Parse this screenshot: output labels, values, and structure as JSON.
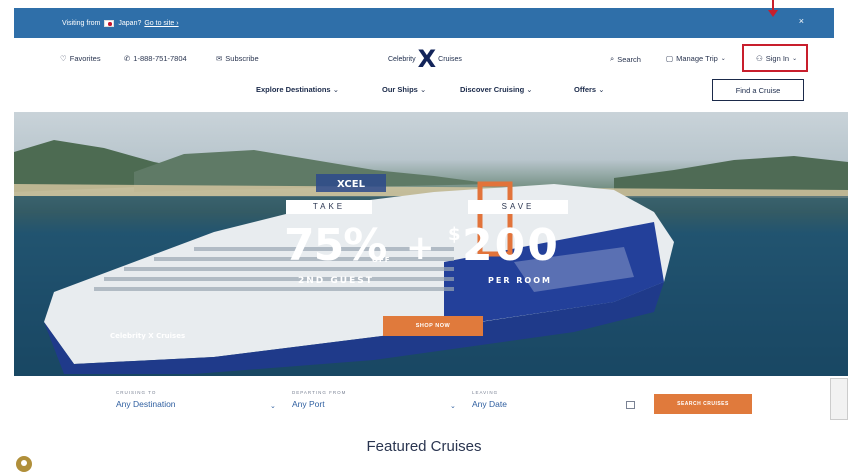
{
  "notice": {
    "visiting": "Visiting from",
    "country": "Japan?",
    "goto": "Go to site ›",
    "close": "×"
  },
  "utility": {
    "favorites": "Favorites",
    "phone": "1-888-751-7804",
    "subscribe": "Subscribe",
    "logo_left": "Celebrity",
    "logo_x": "X",
    "logo_right": "Cruises",
    "search": "Search",
    "manage_trip": "Manage Trip",
    "sign_in": "Sign In"
  },
  "nav": {
    "items": [
      "Explore Destinations",
      "Our Ships",
      "Discover Cruising",
      "Offers"
    ],
    "find_cruise": "Find a Cruise"
  },
  "hero": {
    "take": "TAKE",
    "pct": "75%",
    "off": "OFF",
    "second_guest": "2ND GUEST",
    "plus": "+",
    "dollar": "$",
    "amount": "200",
    "save": "SAVE",
    "per_room": "PER ROOM",
    "shop_now": "SHOP NOW",
    "xcel": "XCEL",
    "ship_logo": "Celebrity X Cruises"
  },
  "search": {
    "cruising_to_label": "CRUISING TO",
    "cruising_to_value": "Any Destination",
    "departing_label": "DEPARTING FROM",
    "departing_value": "Any Port",
    "leaving_label": "LEAVING",
    "leaving_value": "Any Date",
    "button": "SEARCH CRUISES"
  },
  "featured": {
    "title": "Featured Cruises"
  },
  "colors": {
    "notice_bg": "#2f6fa9",
    "accent_orange": "#e07a3c",
    "navy": "#1b2a4a",
    "highlight_red": "#c81e2c"
  }
}
